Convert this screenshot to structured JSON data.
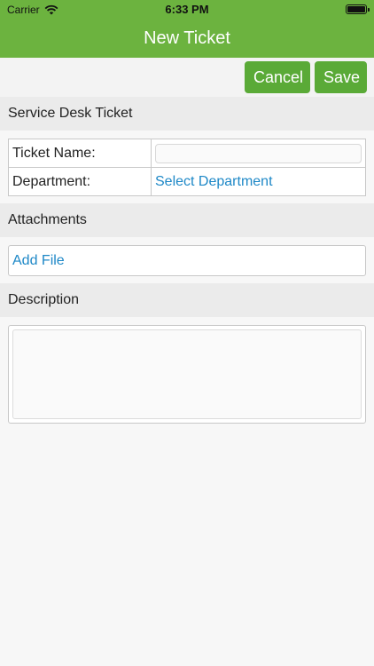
{
  "status_bar": {
    "carrier": "Carrier",
    "time": "6:33 PM"
  },
  "nav": {
    "title": "New Ticket"
  },
  "actions": {
    "cancel_label": "Cancel",
    "save_label": "Save"
  },
  "ticket_section": {
    "header": "Service Desk Ticket",
    "fields": {
      "name_label": "Ticket Name:",
      "name_value": "",
      "department_label": "Department:",
      "department_value": "Select Department"
    }
  },
  "attachments_section": {
    "header": "Attachments",
    "add_file_label": "Add File"
  },
  "description_section": {
    "header": "Description",
    "value": ""
  },
  "colors": {
    "accent": "#6cb33f",
    "button": "#5aaa37",
    "link": "#1e88c7"
  },
  "icons": {
    "wifi": "wifi-icon",
    "battery": "battery-icon"
  }
}
